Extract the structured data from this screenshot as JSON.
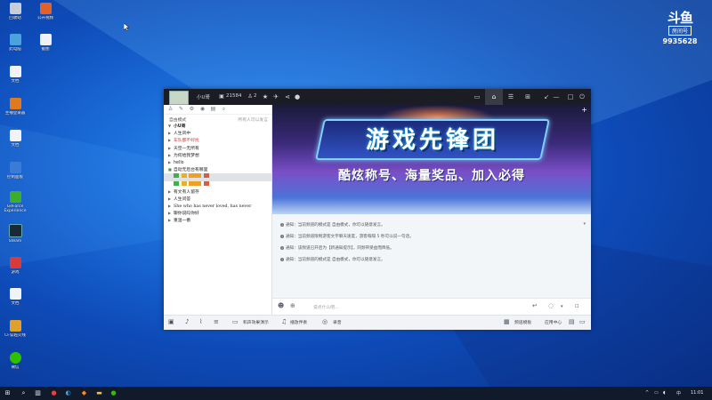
{
  "desktop": {
    "icons": [
      {
        "label": "回收站",
        "color": "#c9ced6"
      },
      {
        "label": "此电脑",
        "color": "#4aa3df"
      },
      {
        "label": "文档",
        "color": "#f1f3f5"
      },
      {
        "label": "主播登录器",
        "color": "#e07a1f"
      },
      {
        "label": "文档",
        "color": "#f1f3f5"
      },
      {
        "label": "控制面板",
        "color": "#3a7bd5"
      },
      {
        "label": "GeForce Experience",
        "color": "#3dae2b"
      },
      {
        "label": "Steam",
        "color": "#1b2838"
      },
      {
        "label": "游戏",
        "color": "#d93a3a"
      },
      {
        "label": "文档",
        "color": "#f1f3f5"
      },
      {
        "label": "CF穿越火线",
        "color": "#e0a12a"
      },
      {
        "label": "微信",
        "color": "#2dc100"
      },
      {
        "label": "公开视频",
        "color": "#e2612a"
      },
      {
        "label": "截图",
        "color": "#eef2f6"
      }
    ]
  },
  "watermark": {
    "logo": "斗鱼",
    "room_label": "房间号",
    "room_number": "9935628"
  },
  "titlebar": {
    "username": "小U哥",
    "id": "21584",
    "count": "2"
  },
  "sidebar": {
    "mode": "自由模式",
    "hint": "所有人可以发言",
    "channels": [
      "小U哥",
      "人生风中",
      "车队都不好扰",
      "天空一无所有",
      "为何给我梦想",
      "hello",
      "自动无后台有哪里",
      "",
      "",
      "有文有人留存",
      "人生问答",
      "She who has never loved, has never",
      "聊你说吗你好",
      "重温一番"
    ]
  },
  "banner": {
    "title": "游戏先锋团",
    "subtitle": "酷炫称号、海量奖品、加入必得"
  },
  "chat": {
    "notices": [
      "通知：当前频道的模式是 自由模式，你可以随意发言。",
      "通知：当前频道限制游客文字聊天速度，游客每隔 5 秒可以说一句话。",
      "通知：该频道已开启为【新通知提示】，同频带受益而降低。",
      "通知：当前频道的模式是 自由模式，你可以随意发言。"
    ]
  },
  "input": {
    "placeholder": "说点什么吧..."
  },
  "bottombar": {
    "label1": "和声效果演示",
    "label2": "播放伴奏",
    "label3": "录音",
    "label4": "频道模板",
    "label5": "应用中心"
  },
  "taskbar": {
    "lang": "中",
    "time": "11:01"
  }
}
